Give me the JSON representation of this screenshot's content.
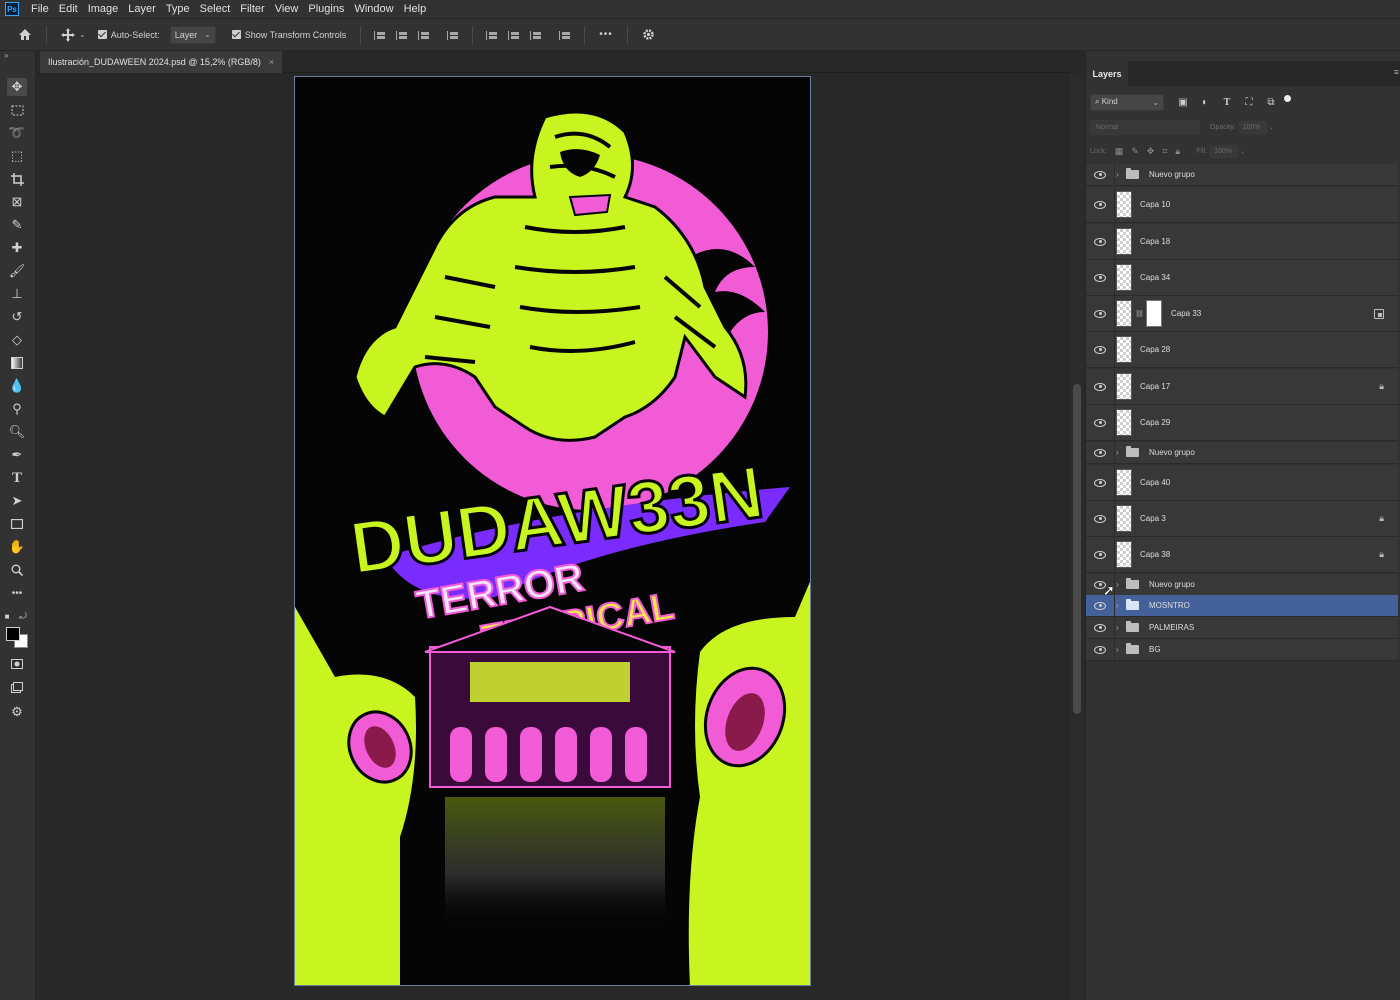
{
  "app": {
    "logo": "Ps"
  },
  "menu": [
    "File",
    "Edit",
    "Image",
    "Layer",
    "Type",
    "Select",
    "Filter",
    "View",
    "Plugins",
    "Window",
    "Help"
  ],
  "options_bar": {
    "auto_select_label": "Auto-Select:",
    "auto_select_checked": true,
    "auto_select_target": "Layer",
    "show_transform_label": "Show Transform Controls",
    "show_transform_checked": true,
    "more_label": "•••"
  },
  "document_tab": {
    "title": "Ilustración_DUDAWEEN 2024.psd @ 15,2% (RGB/8)",
    "close": "×"
  },
  "toolbar": {
    "tools": [
      "move-tool",
      "marquee-tool",
      "lasso-tool",
      "object-select-tool",
      "crop-tool",
      "frame-tool",
      "eyedropper-tool",
      "healing-brush-tool",
      "brush-tool",
      "stamp-tool",
      "history-brush-tool",
      "eraser-tool",
      "gradient-tool",
      "blur-tool",
      "dodge-tool",
      "pen-tool",
      "type-tool",
      "path-select-tool",
      "rectangle-tool",
      "hand-tool",
      "zoom-tool",
      "more-tools"
    ],
    "foreground_color": "#000000",
    "background_color": "#ffffff"
  },
  "artwork": {
    "title_text": "DUDAW33N",
    "subtitle_1": "TERROR",
    "subtitle_2": "TROPICAL",
    "colors": {
      "lime": "#c8f51f",
      "pink": "#f25bd6",
      "purple": "#7a2cff",
      "black": "#050505"
    }
  },
  "layers_panel": {
    "tab_label": "Layers",
    "filter_kind": "Kind",
    "blend_mode": "Normal",
    "opacity_label": "Opacity:",
    "opacity_value": "100%",
    "lock_label": "Lock:",
    "fill_label": "Fill:",
    "fill_value": "100%",
    "layers": [
      {
        "name": "Nuevo grupo",
        "type": "group",
        "selected": false,
        "locked": false
      },
      {
        "name": "Capa 10",
        "type": "layer",
        "selected": false,
        "locked": false
      },
      {
        "name": "Capa 18",
        "type": "layer",
        "selected": false,
        "locked": false
      },
      {
        "name": "Capa 34",
        "type": "layer",
        "selected": false,
        "locked": false
      },
      {
        "name": "Capa 33",
        "type": "masked",
        "selected": false,
        "locked": false
      },
      {
        "name": "Capa 28",
        "type": "layer",
        "selected": false,
        "locked": false
      },
      {
        "name": "Capa 17",
        "type": "layer",
        "selected": false,
        "locked": true
      },
      {
        "name": "Capa 29",
        "type": "layer",
        "selected": false,
        "locked": false
      },
      {
        "name": "Nuevo grupo",
        "type": "group",
        "selected": false,
        "locked": false
      },
      {
        "name": "Capa 40",
        "type": "layer",
        "selected": false,
        "locked": false
      },
      {
        "name": "Capa 3",
        "type": "layer",
        "selected": false,
        "locked": true
      },
      {
        "name": "Capa 38",
        "type": "layer",
        "selected": false,
        "locked": true
      },
      {
        "name": "Nuevo grupo",
        "type": "group",
        "selected": false,
        "locked": false
      },
      {
        "name": "MOSNTRO",
        "type": "group",
        "selected": true,
        "locked": false
      },
      {
        "name": "PALMEIRAS",
        "type": "group",
        "selected": false,
        "locked": false
      },
      {
        "name": "BG",
        "type": "group",
        "selected": false,
        "locked": false
      }
    ]
  }
}
